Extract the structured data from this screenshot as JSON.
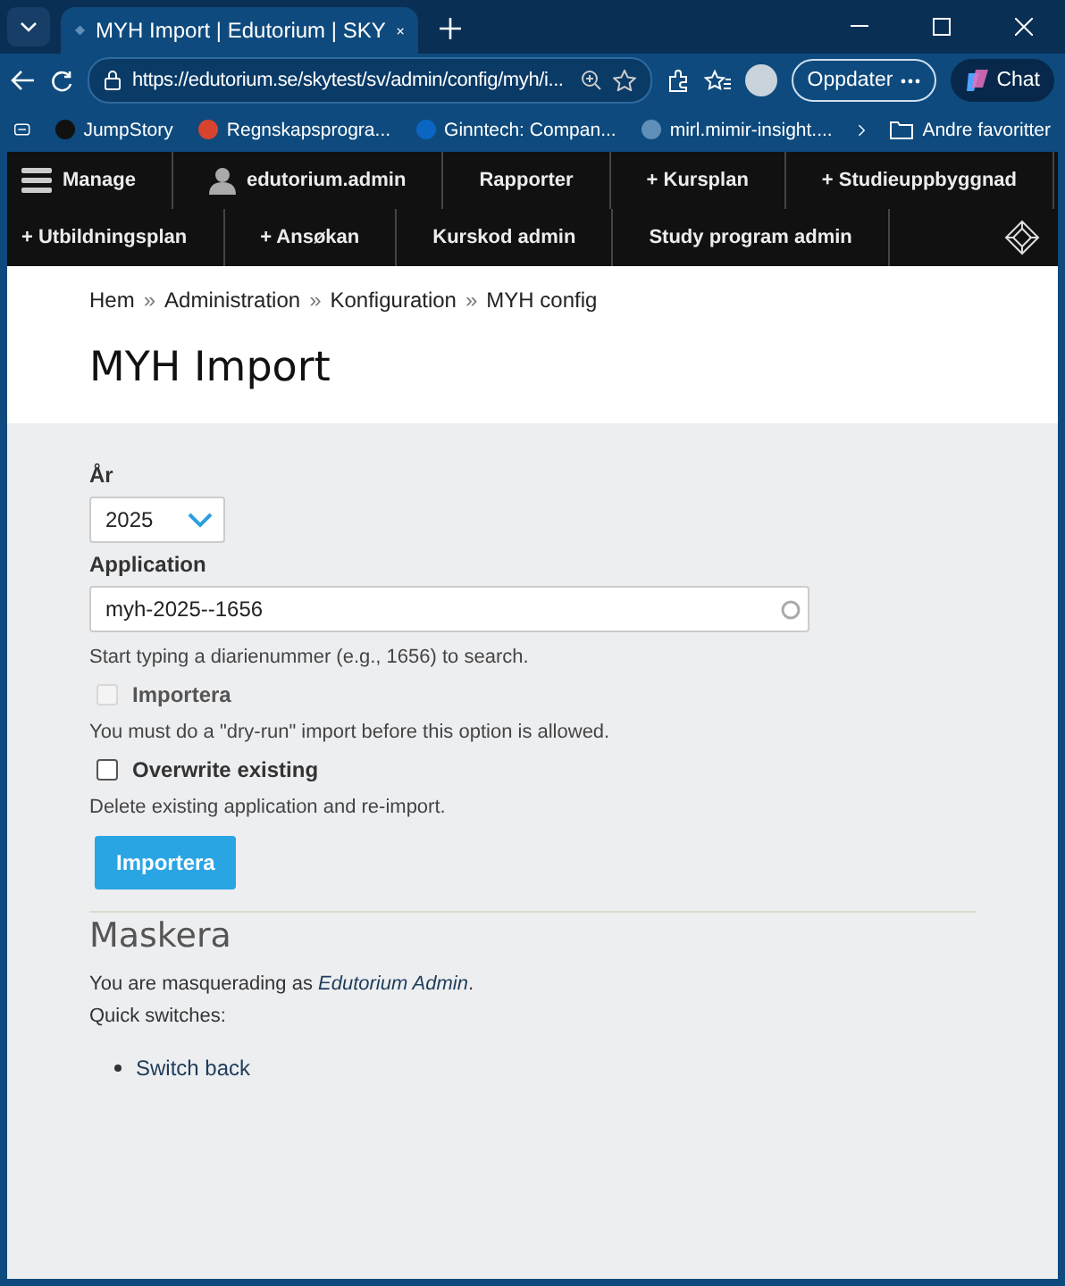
{
  "browser": {
    "tab_title": "MYH Import | Edutorium | SKY",
    "url": "https://edutorium.se/skytest/sv/admin/config/myh/i...",
    "update_button": "Oppdater",
    "chat_button": "Chat",
    "bookmarks": [
      "JumpStory",
      "Regnskapsprogra...",
      "Ginntech: Compan...",
      "mirl.mimir-insight...."
    ],
    "other_favorites": "Andre favoritter"
  },
  "admin_toolbar": {
    "row_1": [
      {
        "label": "Manage",
        "kind": "menu"
      },
      {
        "label": "edutorium.admin",
        "kind": "user"
      },
      {
        "label": "Rapporter"
      },
      {
        "label": "+ Kursplan"
      },
      {
        "label": "+ Studieuppbyggnad"
      }
    ],
    "row_2": [
      {
        "label": "+ Utbildningsplan"
      },
      {
        "label": "+ Ansøkan"
      },
      {
        "label": "Kurskod admin"
      },
      {
        "label": "Study program admin"
      }
    ]
  },
  "breadcrumb": [
    {
      "label": "Hem"
    },
    {
      "label": "Administration"
    },
    {
      "label": "Konfiguration"
    },
    {
      "label": "MYH config"
    }
  ],
  "breadcrumb_separator": "»",
  "title": "MYH Import",
  "form": {
    "year": {
      "label": "År",
      "value": "2025"
    },
    "application": {
      "label": "Application",
      "value": "myh-2025--1656",
      "description": "Start typing a diarienummer (e.g., 1656) to search."
    },
    "checkboxes": [
      {
        "label": "Importera",
        "checked": false,
        "disabled": true,
        "description": "You must do a \"dry-run\" import before this option is allowed."
      },
      {
        "label": "Overwrite existing",
        "checked": false,
        "disabled": false,
        "description": "Delete existing application and re-import."
      }
    ],
    "submit": "Importera"
  },
  "masquerade": {
    "heading": "Maskera",
    "sentence": {
      "prefix": "You are masquerading as ",
      "link": "Edutorium Admin",
      "suffix": "."
    },
    "quick_switches": "Quick switches:",
    "links": [
      "Switch back"
    ]
  }
}
